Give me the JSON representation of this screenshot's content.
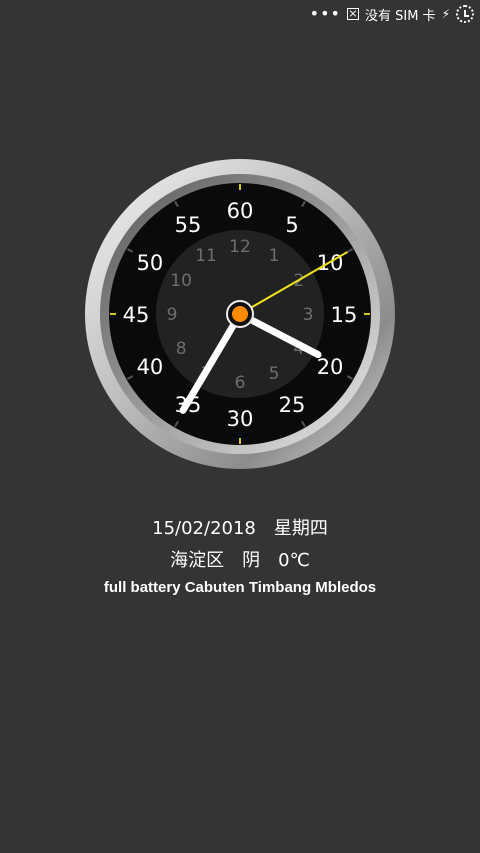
{
  "status_bar": {
    "dots": "•••",
    "sim_text": "没有 SIM 卡",
    "icons": [
      "more-dots-icon",
      "no-sim-icon",
      "charging-bolt-icon",
      "battery-charging-icon"
    ]
  },
  "clock": {
    "outer_labels": [
      "60",
      "5",
      "10",
      "15",
      "20",
      "25",
      "30",
      "35",
      "40",
      "45",
      "50",
      "55"
    ],
    "inner_labels": [
      "12",
      "1",
      "2",
      "3",
      "4",
      "5",
      "6",
      "7",
      "8",
      "9",
      "10",
      "11"
    ],
    "time": {
      "hour": 2,
      "minute": 35,
      "second": 6
    },
    "colors": {
      "second_hand": "#f1e21c",
      "center_cap": "#ff8c00",
      "hand": "#ffffff",
      "face": "#0a0a0a",
      "inner_face": "#222222"
    }
  },
  "info": {
    "date": "15/02/2018",
    "weekday": "星期四",
    "district": "海淀区",
    "weather": "阴",
    "temperature": "0℃",
    "battery_text": "full battery Cabuten Timbang Mbledos"
  }
}
